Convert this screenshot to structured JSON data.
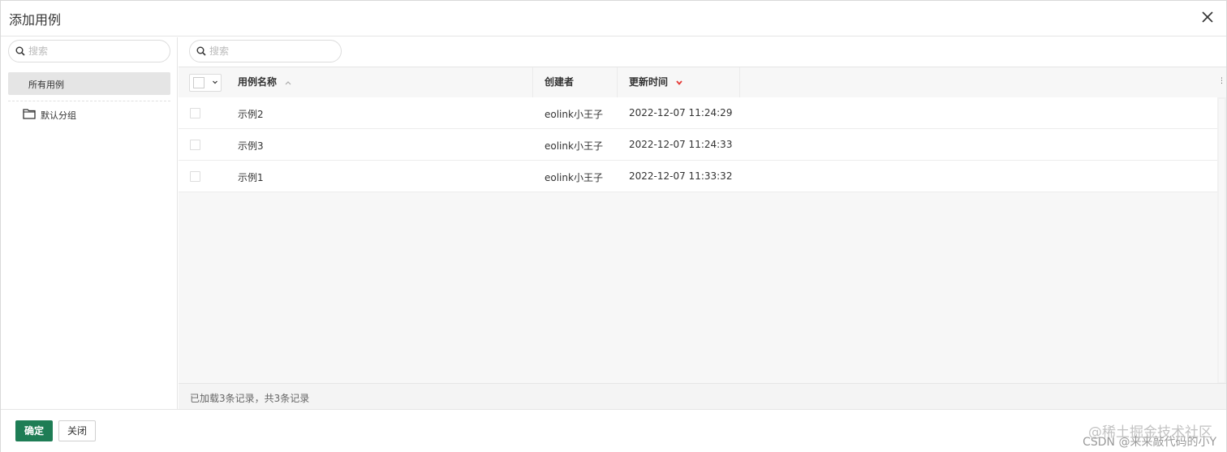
{
  "dialog": {
    "title": "添加用例",
    "close_icon": "close-icon"
  },
  "sidebar": {
    "search_placeholder": "搜索",
    "all_cases_label": "所有用例",
    "groups": [
      {
        "label": "默认分组",
        "icon": "folder-icon"
      }
    ]
  },
  "main": {
    "search_placeholder": "搜索",
    "columns": {
      "name": "用例名称",
      "creator": "创建者",
      "updated": "更新时间"
    },
    "rows": [
      {
        "name": "示例2",
        "creator": "eolink小王子",
        "updated": "2022-12-07 11:24:29"
      },
      {
        "name": "示例3",
        "creator": "eolink小王子",
        "updated": "2022-12-07 11:24:33"
      },
      {
        "name": "示例1",
        "creator": "eolink小王子",
        "updated": "2022-12-07 11:33:32"
      }
    ],
    "status_text": "已加载3条记录，共3条记录",
    "sort": {
      "name": "ascending",
      "updated": "descending"
    }
  },
  "footer": {
    "confirm_label": "确定",
    "close_label": "关闭"
  },
  "watermark": {
    "line1": "@稀土掘金技术社区",
    "line2": "CSDN @来来敲代码的小Y"
  },
  "colors": {
    "primary": "#1e7d55",
    "sort_active": "#e53935",
    "border": "#e5e5e5"
  }
}
